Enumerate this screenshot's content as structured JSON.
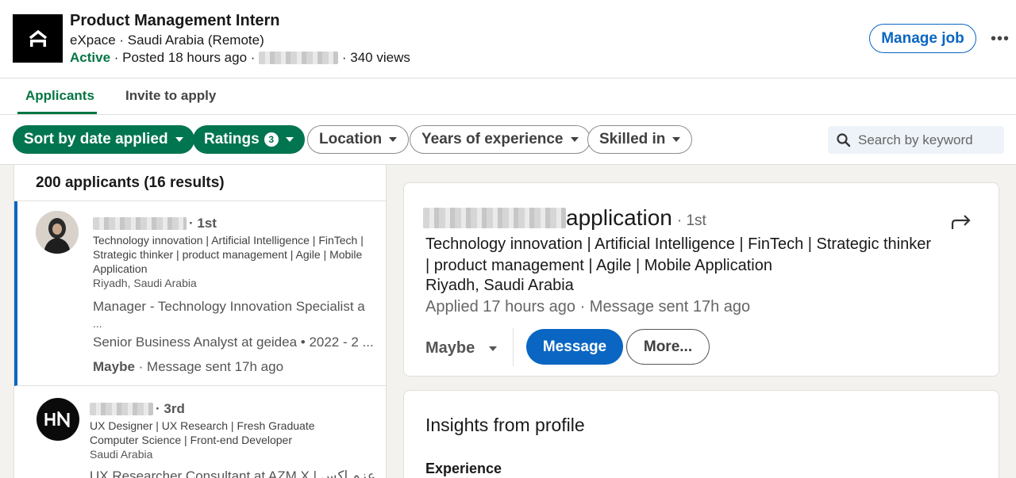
{
  "job": {
    "title": "Product Management Intern",
    "company_location": "eXpace · Saudi Arabia (Remote)",
    "status": "Active",
    "posted": " · Posted 18 hours ago · ",
    "views": " · 340 views",
    "manage_label": "Manage job",
    "more_label": "•••"
  },
  "tabs": [
    {
      "label": "Applicants",
      "active": true
    },
    {
      "label": "Invite to apply",
      "active": false
    }
  ],
  "filters": {
    "sort": "Sort by date applied",
    "ratings": "Ratings",
    "ratings_count": "3",
    "location": "Location",
    "years": "Years of experience",
    "skilled": "Skilled in",
    "search_placeholder": "Search by keyword"
  },
  "list": {
    "count": "200 applicants (16 results)",
    "applicants": [
      {
        "degree": "· 1st",
        "headline": "Technology innovation | Artificial Intelligence | FinTech | Strategic thinker | product management | Agile | Mobile Application",
        "location": "Riyadh, Saudi Arabia",
        "experience_1": "Manager - Technology Innovation Specialist a",
        "experience_1b": "...",
        "experience_2": "Senior Business Analyst at geidea • 2022 - 2 ...",
        "rating": "Maybe",
        "status": " · Message sent 17h ago"
      },
      {
        "degree": "· 3rd",
        "headline": "UX Designer | UX Research | Fresh Graduate Computer Science | Front-end Developer",
        "location": "Saudi Arabia",
        "experience_1": "UX Researcher Consultant at AZM X | عزم اكس"
      }
    ]
  },
  "detail": {
    "title_suffix": "application",
    "degree": "· 1st",
    "headline": "Technology innovation | Artificial Intelligence | FinTech | Strategic thinker | product management | Agile | Mobile Application",
    "location": "Riyadh, Saudi Arabia",
    "applied": "Applied 17 hours ago · Message sent 17h ago",
    "rating": "Maybe",
    "message_label": "Message",
    "more_label": "More..."
  },
  "insights": {
    "title": "Insights from profile",
    "experience_heading": "Experience"
  },
  "colors": {
    "accent_green": "#01754f",
    "link_blue": "#0a66c2",
    "active_green": "#057642"
  }
}
